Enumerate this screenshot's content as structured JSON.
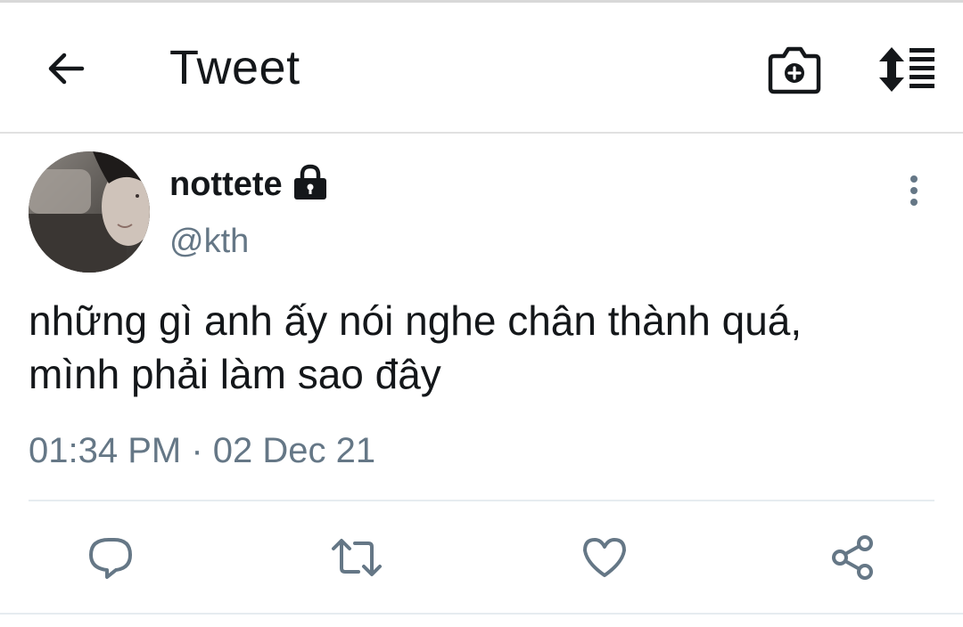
{
  "header": {
    "title": "Tweet",
    "icons": [
      "back-arrow-icon",
      "camera-add-icon",
      "sort-list-icon"
    ]
  },
  "tweet": {
    "display_name": "nottete",
    "protected_icon": "lock-icon",
    "handle": "@kth",
    "text_lines": [
      "những gì anh ấy nói nghe chân thành quá,",
      "mình phải làm sao đây"
    ],
    "timestamp": "01:34 PM · 02 Dec 21",
    "more_icon": "more-vertical-icon"
  },
  "actions": [
    {
      "name": "reply",
      "icon": "reply-icon"
    },
    {
      "name": "retweet",
      "icon": "retweet-icon"
    },
    {
      "name": "like",
      "icon": "heart-icon"
    },
    {
      "name": "share",
      "icon": "share-icon"
    }
  ],
  "colors": {
    "text_primary": "#14171a",
    "text_secondary": "#657786",
    "divider": "#e6ecf0"
  }
}
